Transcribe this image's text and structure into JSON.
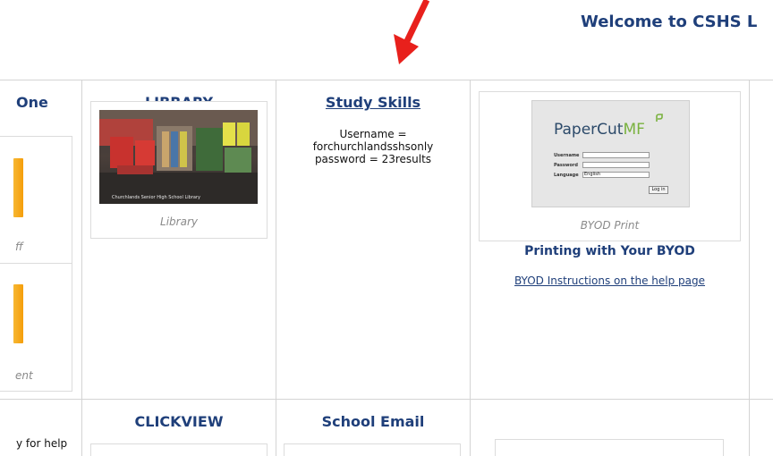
{
  "header": {
    "welcome_text": "Welcome to CSHS L"
  },
  "left_column": {
    "title": "One",
    "caption_1": "ff",
    "caption_2": "ent",
    "bottom_text": "y for help"
  },
  "library": {
    "title": "LIBRARY",
    "image_label": "Churchlands Senior High School Library",
    "caption": "Library"
  },
  "study_skills": {
    "title": "Study Skills",
    "line1": "Username =",
    "line2": "forchurchlandsshsonly",
    "line3": "password = 23results"
  },
  "byod": {
    "image": {
      "logo_text": "PaperCut",
      "logo_mf": "MF",
      "username_label": "Username",
      "password_label": "Password",
      "language_label": "Language",
      "language_value": "English",
      "login_button": "Log in"
    },
    "caption": "BYOD Print",
    "heading": "Printing with Your BYOD",
    "link": "BYOD Instructions on the help page"
  },
  "row2": {
    "clickview_title": "CLICKVIEW",
    "email_title": "School Email"
  },
  "colors": {
    "heading_blue": "#1f3f7a",
    "annotation_red": "#e8201c",
    "papercut_green": "#7ab23f"
  }
}
